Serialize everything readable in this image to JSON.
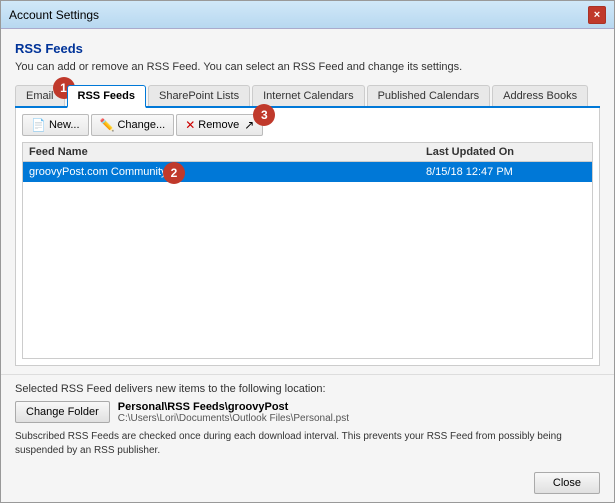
{
  "window": {
    "title": "Account Settings",
    "close_btn": "×"
  },
  "section": {
    "title": "RSS Feeds",
    "description": "You can add or remove an RSS Feed. You can select an RSS Feed and change its settings."
  },
  "tabs": [
    {
      "id": "email",
      "label": "Email"
    },
    {
      "id": "rss-feeds",
      "label": "RSS Feeds",
      "active": true
    },
    {
      "id": "sharepoint",
      "label": "SharePoint Lists"
    },
    {
      "id": "internet-cal",
      "label": "Internet Calendars"
    },
    {
      "id": "published-cal",
      "label": "Published Calendars"
    },
    {
      "id": "address-books",
      "label": "Address Books"
    }
  ],
  "toolbar": {
    "new_label": "New...",
    "change_label": "Change...",
    "remove_label": "Remove"
  },
  "table": {
    "columns": [
      {
        "id": "feed-name",
        "label": "Feed Name"
      },
      {
        "id": "last-updated",
        "label": "Last Updated On"
      }
    ],
    "rows": [
      {
        "feed_name": "groovyPost.com Community",
        "last_updated": "8/15/18 12:47 PM",
        "selected": true
      }
    ]
  },
  "bottom": {
    "location_label": "Selected RSS Feed delivers new items to the following location:",
    "change_folder_label": "Change Folder",
    "folder_path": "Personal\\RSS Feeds\\groovyPost",
    "folder_file": "C:\\Users\\Lori\\Documents\\Outlook Files\\Personal.pst",
    "subscribe_note": "Subscribed RSS Feeds are checked once during each download interval. This prevents your RSS Feed from possibly being suspended by an RSS publisher."
  },
  "footer": {
    "close_label": "Close"
  },
  "annotations": {
    "bubble1": "1",
    "bubble2": "2",
    "bubble3": "3"
  },
  "icons": {
    "new_icon": "📄",
    "change_icon": "✏️",
    "remove_icon": "✕"
  }
}
